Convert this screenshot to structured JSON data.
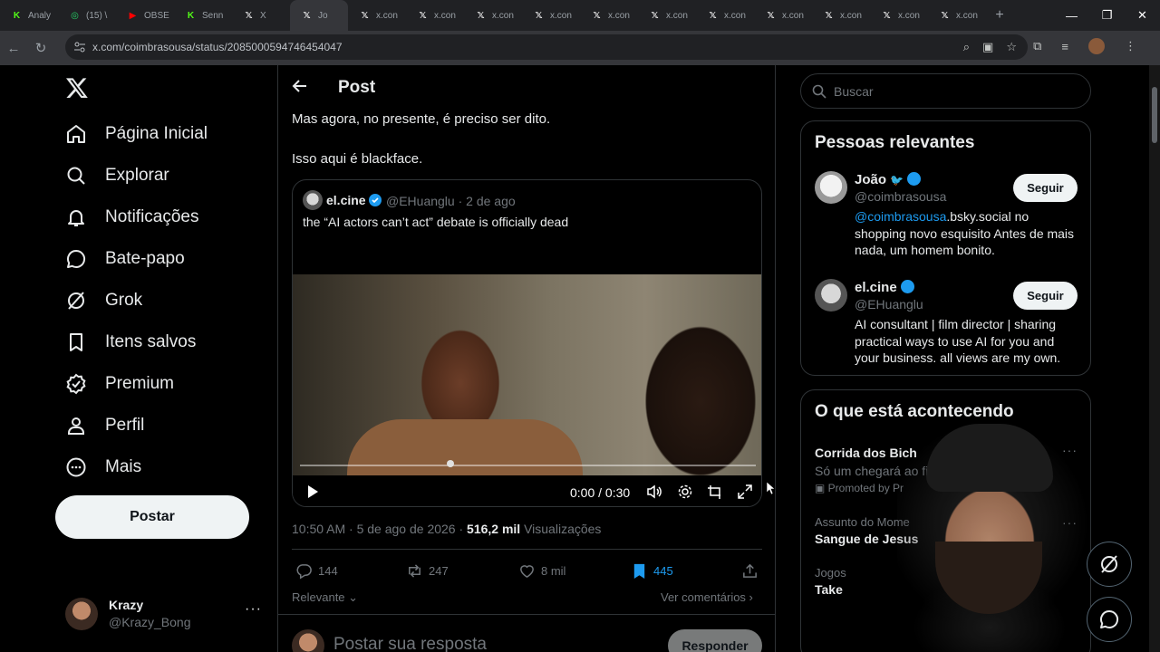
{
  "browser": {
    "tabs": [
      {
        "title": "Analy",
        "favicon": "K",
        "color": "#53fc18"
      },
      {
        "title": "(15) \\",
        "favicon": "whatsapp",
        "color": "#25d366"
      },
      {
        "title": "OBSE",
        "favicon": "youtube",
        "color": "#ff0000"
      },
      {
        "title": "Senn",
        "favicon": "K",
        "color": "#53fc18"
      },
      {
        "title": "X",
        "favicon": "X",
        "color": "#ffffff"
      },
      {
        "title": "Jo",
        "favicon": "X",
        "color": "#ffffff"
      },
      {
        "title": "x.con",
        "favicon": "X",
        "color": "#ffffff"
      },
      {
        "title": "x.con",
        "favicon": "X",
        "color": "#ffffff"
      },
      {
        "title": "x.con",
        "favicon": "X",
        "color": "#ffffff"
      },
      {
        "title": "x.con",
        "favicon": "X",
        "color": "#ffffff"
      },
      {
        "title": "x.con",
        "favicon": "X",
        "color": "#ffffff"
      },
      {
        "title": "x.con",
        "favicon": "X",
        "color": "#ffffff"
      },
      {
        "title": "x.con",
        "favicon": "X",
        "color": "#ffffff"
      },
      {
        "title": "x.con",
        "favicon": "X",
        "color": "#ffffff"
      },
      {
        "title": "x.con",
        "favicon": "X",
        "color": "#ffffff"
      },
      {
        "title": "x.con",
        "favicon": "X",
        "color": "#ffffff"
      },
      {
        "title": "x.con",
        "favicon": "X",
        "color": "#ffffff"
      }
    ],
    "new_tab": "+",
    "url": "x.com/coimbrasousa/status/2085000594746454047",
    "controls": {
      "minimize": "—",
      "maximize": "❐",
      "close": "✕"
    }
  },
  "nav": {
    "items": [
      {
        "label": "Página Inicial",
        "icon": "home-icon"
      },
      {
        "label": "Explorar",
        "icon": "search-icon"
      },
      {
        "label": "Notificações",
        "icon": "bell-icon"
      },
      {
        "label": "Bate-papo",
        "icon": "chat-icon"
      },
      {
        "label": "Grok",
        "icon": "grok-icon"
      },
      {
        "label": "Itens salvos",
        "icon": "bookmark-icon"
      },
      {
        "label": "Premium",
        "icon": "verified-badge-icon"
      },
      {
        "label": "Perfil",
        "icon": "person-icon"
      },
      {
        "label": "Mais",
        "icon": "more-circle-icon"
      }
    ],
    "post_button": "Postar",
    "account": {
      "name": "Krazy",
      "handle": "@Krazy_Bong",
      "more": "···"
    }
  },
  "main": {
    "title": "Post",
    "text_line1": "Mas agora, no presente, é preciso ser dito.",
    "text_line2": "Isso aqui é blackface.",
    "quote": {
      "name": "el.cine",
      "handle": "@EHuanglu · 2 de ago",
      "text": "the “AI actors can’t act” debate is officially dead"
    },
    "video": {
      "time": "0:00 / 0:30",
      "progress": 0.33
    },
    "meta": {
      "time_date": "10:50 AM · 5 de ago de 2026 · ",
      "views": "516,2 mil",
      "views_label": " Visualizações"
    },
    "actions": {
      "replies": "144",
      "reposts": "247",
      "likes": "8 mil",
      "bookmarks": "445"
    },
    "sort": "Relevante",
    "see_comments": "Ver comentários",
    "reply_placeholder": "Postar sua resposta",
    "reply_button": "Responder",
    "accent": "#1d9bf0"
  },
  "sidebar": {
    "search_placeholder": "Buscar",
    "people_title": "Pessoas relevantes",
    "people": [
      {
        "name": "João",
        "handle": "@coimbrasousa",
        "bio_mention": "@coimbrasousa",
        "bio_rest": ".bsky.social no shopping novo esquisito Antes de mais nada, um homem bonito.",
        "follow": "Seguir"
      },
      {
        "name": "el.cine",
        "handle": "@EHuanglu",
        "bio_mention": "",
        "bio_rest": "AI consultant | film director | sharing practical ways to use AI for you and your business. all views are my own.",
        "follow": "Seguir"
      }
    ],
    "trends_title": "O que está acontecendo",
    "trends": [
      {
        "title": "Corrida dos Bich",
        "sub": "Só um chegará ao fi",
        "promo": "Promoted by Pr"
      },
      {
        "label": "Assunto do Mome",
        "title": "Sangue de Jesus"
      },
      {
        "label": "Jogos",
        "title": "Take"
      }
    ]
  }
}
